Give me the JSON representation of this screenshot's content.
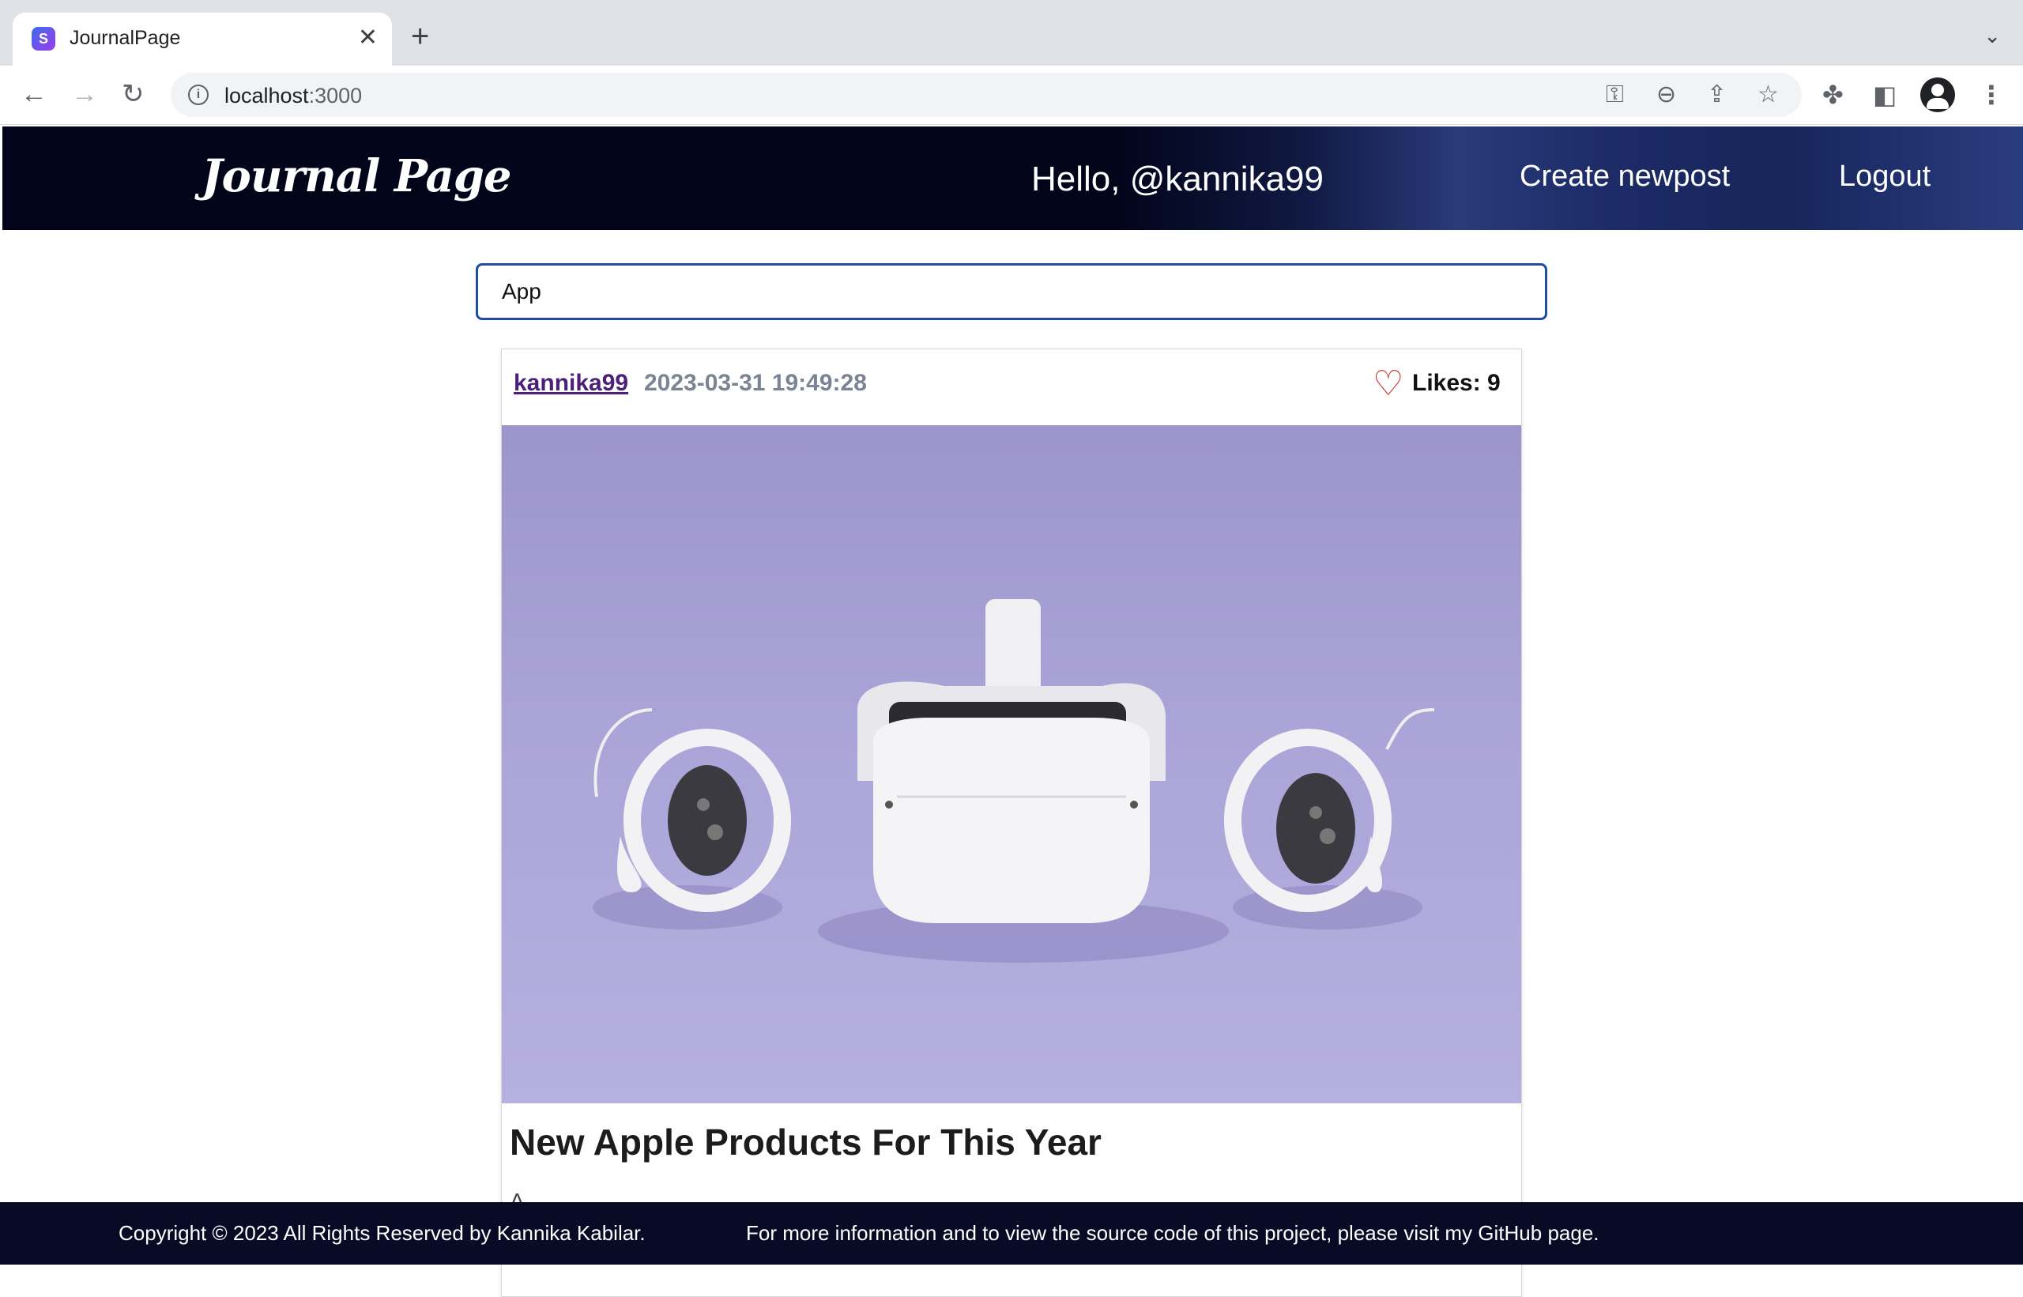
{
  "browser": {
    "tab_title": "JournalPage",
    "tab_favicon": "S",
    "url_host": "localhost",
    "url_port": ":3000"
  },
  "navbar": {
    "brand": "Journal Page",
    "greeting": "Hello, @kannika99",
    "create_link": "Create newpost",
    "logout_link": "Logout"
  },
  "search": {
    "value": "App"
  },
  "post": {
    "author": "kannika99",
    "date": "2023-03-31 19:49:28",
    "likes_label": "Likes: 9",
    "title": "New Apple Products For This Year",
    "excerpt": "A ... ... ..."
  },
  "footer": {
    "copyright": "Copyright © 2023 All Rights Reserved by Kannika Kabilar.",
    "info": "For more information and to view the source code of this project, please visit my GitHub page."
  },
  "colors": {
    "navbar_dark": "#02041a",
    "search_border": "#1f4ea3",
    "author_link": "#4b1f7a",
    "heart": "#c4302b",
    "footer_bg": "#080a26"
  },
  "icons": [
    "back-arrow-icon",
    "forward-arrow-icon",
    "reload-icon",
    "info-icon",
    "key-icon",
    "zoom-out-icon",
    "share-icon",
    "star-icon",
    "puzzle-icon",
    "side-panel-icon",
    "profile-icon",
    "more-vert-icon",
    "heart-icon"
  ]
}
